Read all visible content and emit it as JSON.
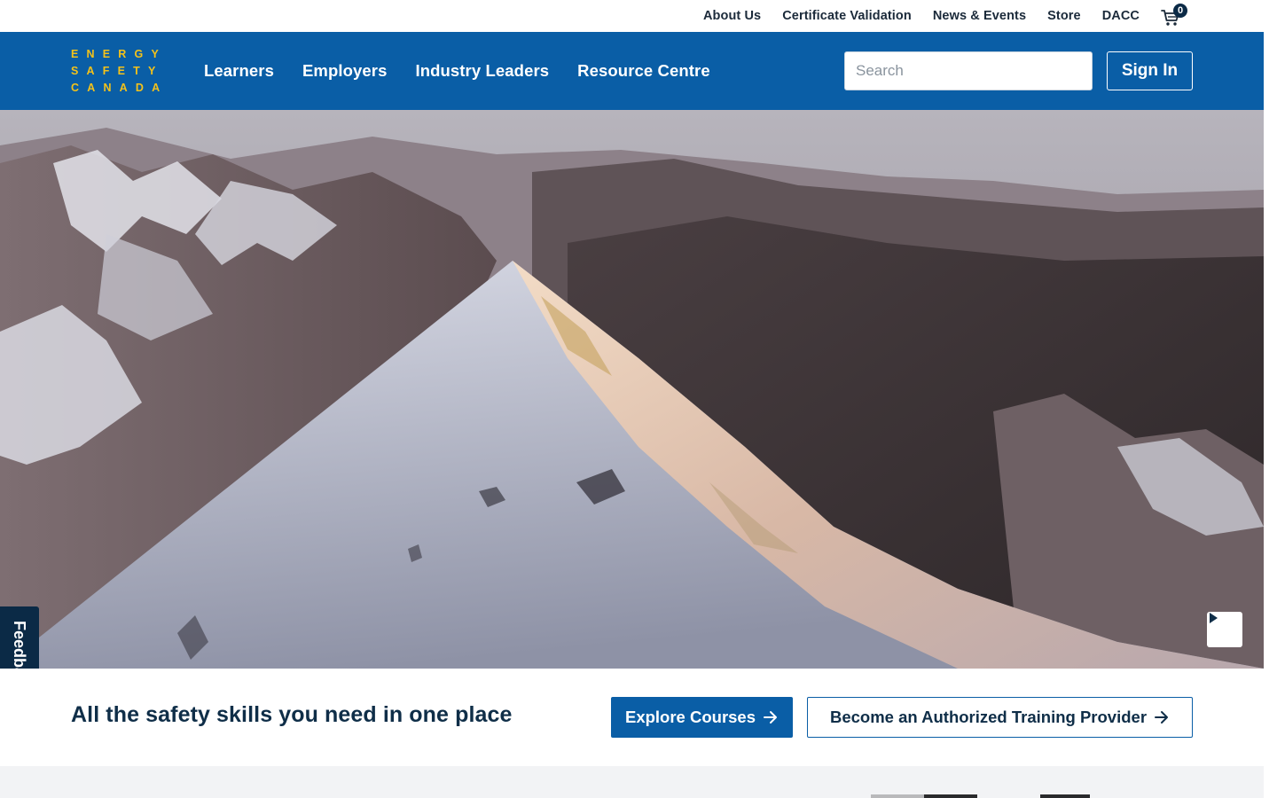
{
  "utility_nav": {
    "links": [
      "About Us",
      "Certificate Validation",
      "News & Events",
      "Store",
      "DACC"
    ],
    "cart": {
      "icon": "cart-icon",
      "count": "0"
    }
  },
  "header": {
    "logo": [
      "ENERGY",
      "SAFETY",
      "CANADA"
    ],
    "nav": [
      "Learners",
      "Employers",
      "Industry Leaders",
      "Resource Centre"
    ],
    "search": {
      "placeholder": "Search",
      "value": ""
    },
    "sign_in_label": "Sign In"
  },
  "hero": {
    "play_icon": "play-icon"
  },
  "feedback": {
    "label": "Feedback",
    "icon": "feedback-icon"
  },
  "tagline_section": {
    "tagline": "All the safety skills you need in one place",
    "explore_label": "Explore Courses",
    "provider_label": "Become an Authorized Training Provider",
    "arrow_icon": "arrow-right-icon"
  },
  "colors": {
    "brand_blue": "#0a5ea6",
    "logo_gold": "#f4c21a",
    "dark_navy": "#0f2e48"
  }
}
